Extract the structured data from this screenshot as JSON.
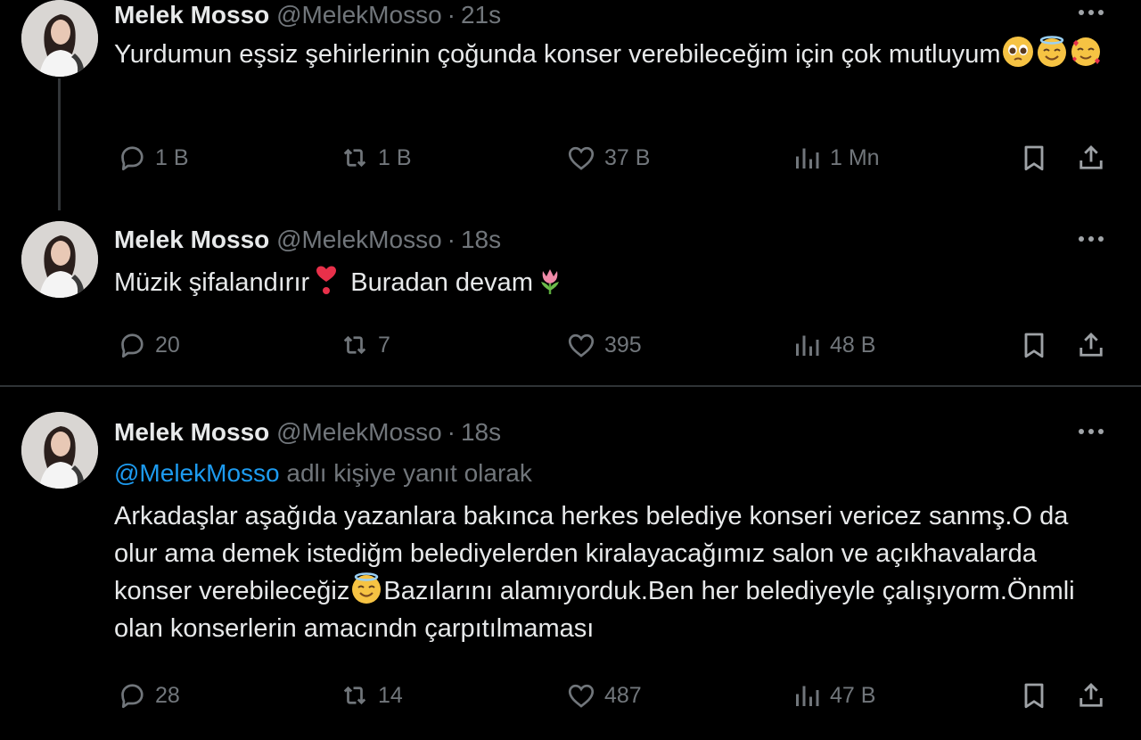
{
  "tweets": [
    {
      "name": "Melek Mosso",
      "handle": "@MelekMosso",
      "time": "21s",
      "text_before": "Yurdumun eşsiz şehirlerinin çoğunda konser verebileceğim için çok mutluyum",
      "emojis": [
        "pleading-face-emoji",
        "smiling-face-with-halo-emoji",
        "smiling-face-with-hearts-emoji"
      ],
      "replies": "1 B",
      "reposts": "1 B",
      "likes": "37 B",
      "views": "1 Mn"
    },
    {
      "name": "Melek Mosso",
      "handle": "@MelekMosso",
      "time": "18s",
      "text_part1": "Müzik şifalandırır",
      "text_part2": " Buradan devam",
      "emojis": [
        "heart-exclamation-emoji",
        "tulip-emoji"
      ],
      "replies": "20",
      "reposts": "7",
      "likes": "395",
      "views": "48 B"
    },
    {
      "name": "Melek Mosso",
      "handle": "@MelekMosso",
      "time": "18s",
      "reply_mention": "@MelekMosso",
      "reply_suffix": " adlı kişiye yanıt olarak",
      "text_part1": "Arkadaşlar aşağıda yazanlara bakınca herkes belediye konseri vericez sanmş.O da olur ama demek istediğm belediyelerden kiralayacağımız salon ve açıkhavalarda konser verebileceğiz",
      "text_part2": "Bazılarını alamıyorduk.Ben her belediyeyle çalışıyorm.Önmli olan konserlerin amacındn çarpıtılmaması",
      "emojis": [
        "smiling-face-with-halo-emoji"
      ],
      "replies": "28",
      "reposts": "14",
      "likes": "487",
      "views": "47 B"
    }
  ],
  "icons": {
    "reply": "reply-icon",
    "repost": "repost-icon",
    "like": "heart-icon",
    "views": "views-chart-icon",
    "bookmark": "bookmark-icon",
    "share": "share-icon",
    "more": "more-options-icon"
  },
  "colors": {
    "background": "#000000",
    "text": "#e7e9ea",
    "secondary": "#71767b",
    "mention": "#1d9bf0",
    "divider": "#2f3336"
  }
}
